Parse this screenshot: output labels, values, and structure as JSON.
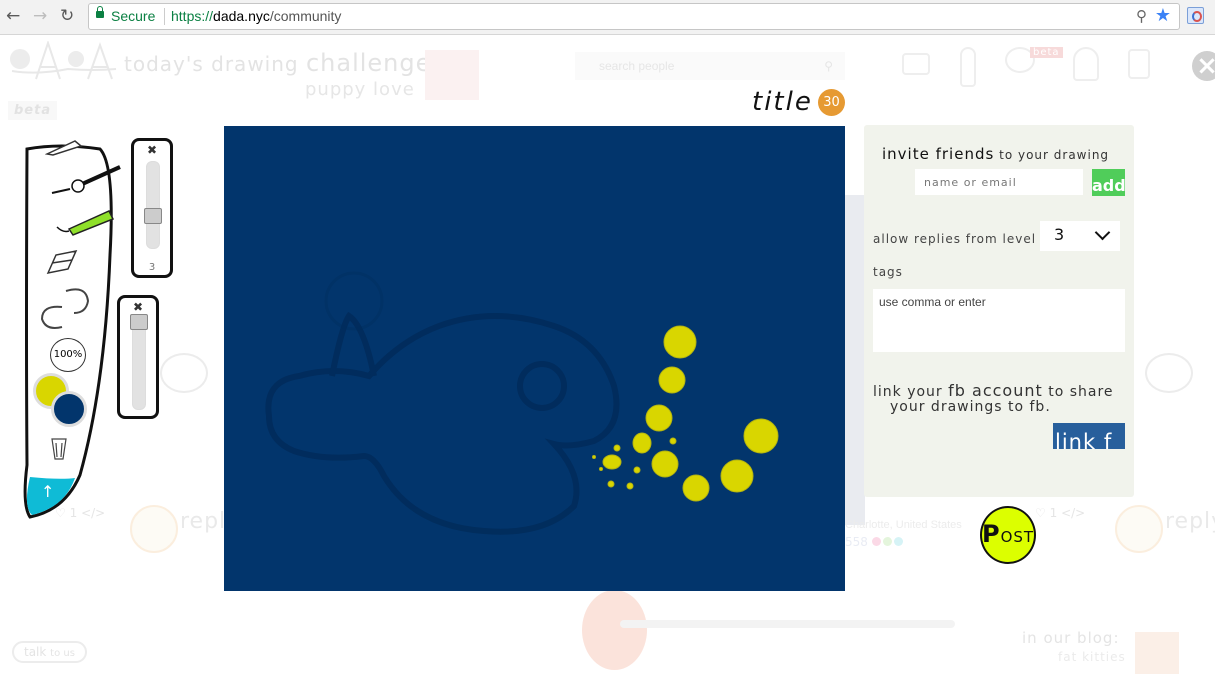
{
  "browser": {
    "secure_label": "Secure",
    "url_scheme": "https://",
    "url_host": "dada.nyc",
    "url_path": "/community",
    "icons": [
      "back-icon",
      "forward-icon",
      "reload-icon",
      "lock-icon",
      "zoom-out-icon",
      "bookmark-star-icon",
      "extension-icon"
    ]
  },
  "background_page": {
    "challenge_prefix": "today's drawing ",
    "challenge_word": "challenge:",
    "challenge_topic": "puppy love",
    "beta_label": "beta",
    "search_placeholder": "search people",
    "header_beta": "beta",
    "reply_label": "reply",
    "likes_count": "1",
    "code_glyph": "</>",
    "location": "Charlotte, United States",
    "count": "558",
    "talk_label": "talk",
    "talk_suffix": "to us",
    "blog_label": "in our blog:",
    "blog_topic": "fat kitties",
    "dot_colors": [
      "#fbd9e6",
      "#e4f5dc",
      "#d6f3f6"
    ]
  },
  "editor": {
    "title": "title",
    "title_remaining": "30",
    "canvas_background": "#02356c",
    "toolbar": {
      "tools": [
        "pencil-icon",
        "brush-icon",
        "marker-icon",
        "eraser-icon",
        "undo-redo-icon",
        "zoom-100-icon",
        "trash-icon",
        "upload-arrow-icon"
      ],
      "zoom_label": "100%",
      "primary_color": "#d9d600",
      "secondary_color": "#02356c",
      "size_slider_value": "3",
      "size_slider_fraction": 0.65,
      "opacity_slider_fraction": 0.0
    },
    "panel": {
      "invite_big": "invite friends",
      "invite_small": " to your drawing",
      "name_placeholder": "name or email",
      "add_label": "add",
      "allow_label": "allow replies from level",
      "level_value": "3",
      "tags_label": "tags",
      "tags_placeholder": "use comma or enter",
      "fb_prefix": "link your ",
      "fb_big": "fb account",
      "fb_suffix": " to share",
      "fb_line2": "your drawings to fb.",
      "link_label": "link  f"
    },
    "post_p": "P",
    "post_rest": "OST"
  }
}
